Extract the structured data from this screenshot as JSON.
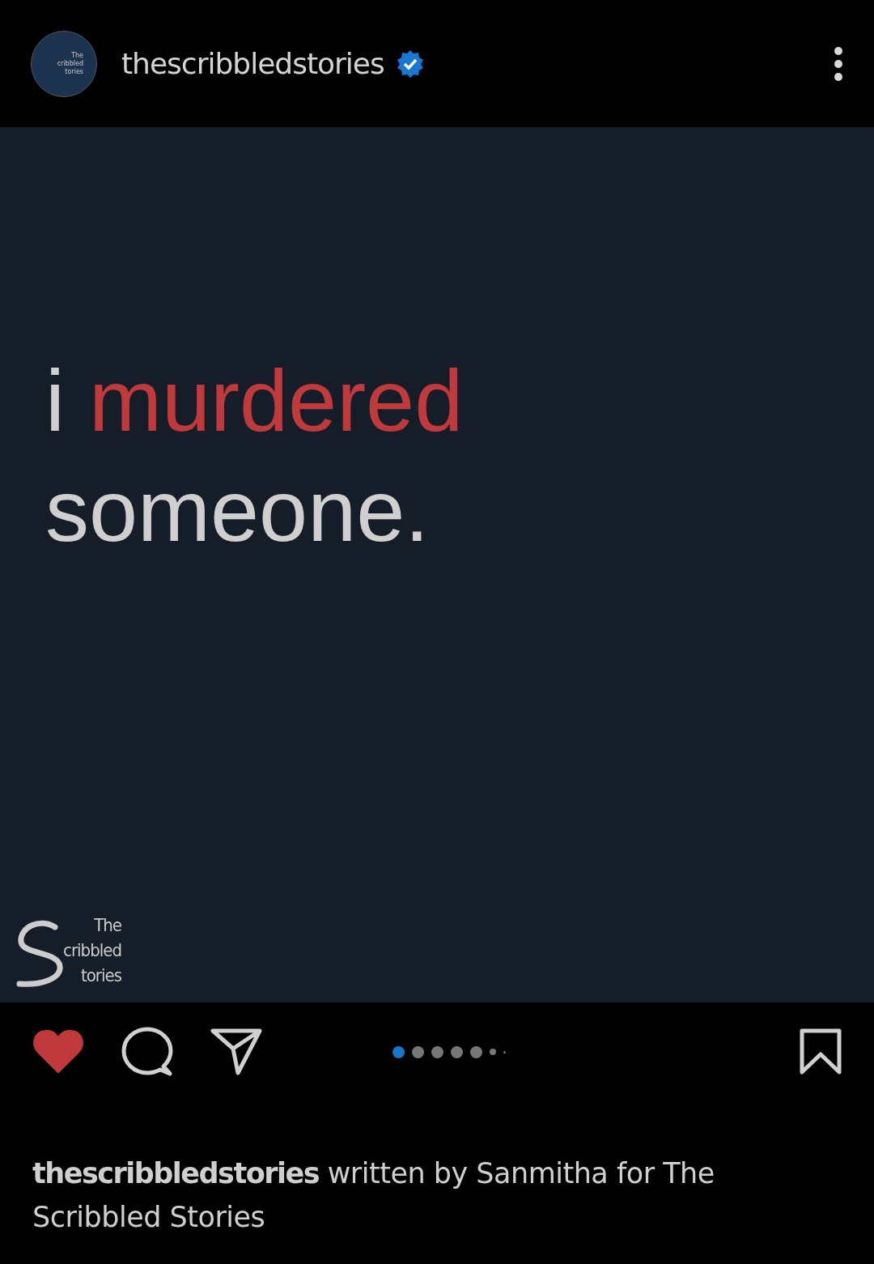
{
  "header": {
    "avatar": {
      "lines": [
        "The",
        "cribbled",
        "tories"
      ]
    },
    "username": "thescribbledstories",
    "verified": true
  },
  "post": {
    "headline": [
      {
        "text": "i",
        "kind": "plain"
      },
      {
        "text": "murdered",
        "kind": "accent"
      },
      {
        "text": "someone.",
        "kind": "plain"
      }
    ],
    "logo": {
      "lines": [
        "The",
        "cribbled",
        "tories"
      ]
    }
  },
  "actions": {
    "liked": true,
    "saved": false,
    "dots": [
      {
        "selected": true,
        "kind": "full"
      },
      {
        "selected": false,
        "kind": "full"
      },
      {
        "selected": false,
        "kind": "full"
      },
      {
        "selected": false,
        "kind": "full"
      },
      {
        "selected": false,
        "kind": "full"
      },
      {
        "selected": false,
        "kind": "small"
      },
      {
        "selected": false,
        "kind": "tiny"
      }
    ]
  },
  "caption": {
    "username": "thescribbledstories",
    "text": "written by Sanmitha for The Scribbled Stories"
  }
}
